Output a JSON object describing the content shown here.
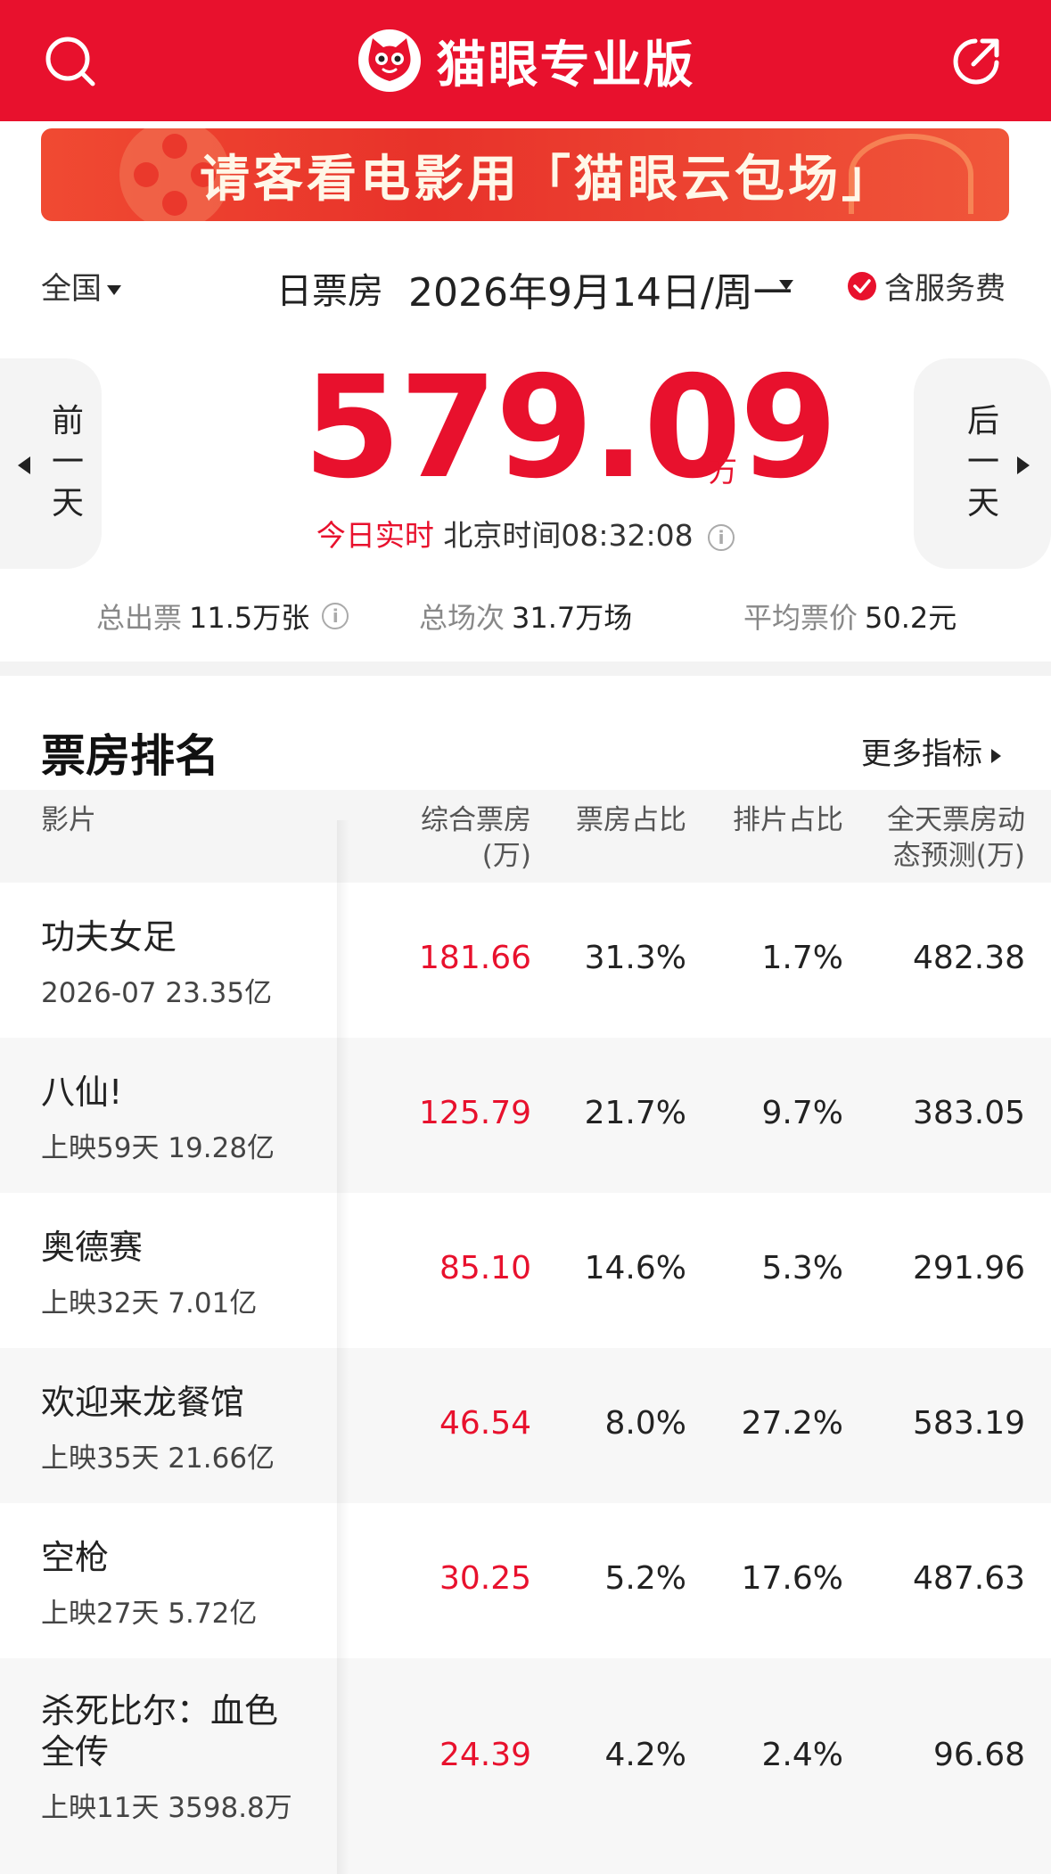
{
  "header": {
    "title": "猫眼专业版",
    "search_icon": "search-icon",
    "share_icon": "share-icon",
    "brand_color": "#e8112d"
  },
  "banner": {
    "text": "请客看电影用「猫眼云包场」"
  },
  "filters": {
    "region": "全国",
    "mode": "日票房",
    "date": "2026年9月14日/周一",
    "service_fee": "含服务费"
  },
  "summary": {
    "prev_day": "前一天",
    "next_day": "后一天",
    "total": "579.09",
    "unit": "万",
    "realtime_label": "今日实时",
    "time_label": "北京时间08:32:08"
  },
  "stats": {
    "tickets_label": "总出票",
    "tickets_value": "11.5万张",
    "shows_label": "总场次",
    "shows_value": "31.7万场",
    "price_label": "平均票价",
    "price_value": "50.2元"
  },
  "ranking": {
    "title": "票房排名",
    "more": "更多指标",
    "columns": {
      "film": "影片",
      "box_office_line1": "综合票房",
      "box_office_line2": "(万)",
      "bo_share": "票房占比",
      "schedule_share": "排片占比",
      "prediction_line1": "全天票房动",
      "prediction_line2": "态预测(万)"
    },
    "rows": [
      {
        "name": "功夫女足",
        "sub": "2026-07 23.35亿",
        "box_office": "181.66",
        "bo_share": "31.3%",
        "schedule_share": "1.7%",
        "prediction": "482.38"
      },
      {
        "name": "八仙!",
        "sub": "上映59天 19.28亿",
        "box_office": "125.79",
        "bo_share": "21.7%",
        "schedule_share": "9.7%",
        "prediction": "383.05"
      },
      {
        "name": "奥德赛",
        "sub": "上映32天 7.01亿",
        "box_office": "85.10",
        "bo_share": "14.6%",
        "schedule_share": "5.3%",
        "prediction": "291.96"
      },
      {
        "name": "欢迎来龙餐馆",
        "sub": "上映35天 21.66亿",
        "box_office": "46.54",
        "bo_share": "8.0%",
        "schedule_share": "27.2%",
        "prediction": "583.19"
      },
      {
        "name": "空枪",
        "sub": "上映27天 5.72亿",
        "box_office": "30.25",
        "bo_share": "5.2%",
        "schedule_share": "17.6%",
        "prediction": "487.63"
      },
      {
        "name": "杀死比尔：血色全传",
        "sub": "上映11天 3598.8万",
        "box_office": "24.39",
        "bo_share": "4.2%",
        "schedule_share": "2.4%",
        "prediction": "96.68"
      }
    ]
  }
}
